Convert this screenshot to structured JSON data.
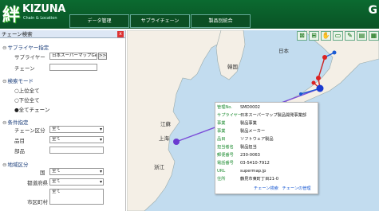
{
  "header": {
    "logo_kanji": "絆",
    "logo_text": "KIZUNA",
    "logo_sub": "Chain & Location",
    "tabs": [
      "データ管理",
      "サプライチェーン",
      "製品別統合"
    ],
    "right_mark": "G"
  },
  "sidebar": {
    "title": "チェーン検索",
    "close": "x",
    "supplier_section": "サプライヤー指定",
    "supplier_label": "サプライヤー",
    "supplier_value": "日本スーパーマップGeo",
    "supplier_btn": ">>",
    "chain_label": "チェーン",
    "chain_value": "",
    "mode_section": "検索モード",
    "modes": [
      "上位全て",
      "下位全て",
      "全てチェーン"
    ],
    "mode_selected": 2,
    "cond_section": "条件指定",
    "chain_cat_label": "チェーン区分",
    "chain_cat_value": "全て",
    "item_label": "品目",
    "item_value": "全て",
    "part_label": "部品",
    "part_value": "",
    "region_section": "地域区分",
    "country_label": "国",
    "country_value": "全て",
    "pref_label": "都道府県",
    "pref_value": "全て",
    "city_label": "市区町村",
    "city_value": "全て"
  },
  "map": {
    "labels": {
      "japan": "日本",
      "korea": "韓国",
      "shanghai": "上海",
      "jiangsu": "江蘇",
      "zhejiang": "浙江"
    },
    "tools": [
      "zoom-out-icon",
      "zoom-in-icon",
      "pan-icon",
      "rect-select-icon",
      "measure-icon",
      "layer-icon",
      "print-icon"
    ],
    "tool_glyphs": [
      "⊠",
      "⊞",
      "✋",
      "▭",
      "✎",
      "▤",
      "▦"
    ]
  },
  "popup": {
    "rows": [
      {
        "k": "管理No.",
        "v": "SMD0002"
      },
      {
        "k": "サプライヤー",
        "v": "日本スーパーマップ製品開発事業部"
      },
      {
        "k": "事業",
        "v": "製品事業"
      },
      {
        "k": "事業",
        "v": "製品メーカー"
      },
      {
        "k": "品目",
        "v": "ソフトウェア製品"
      },
      {
        "k": "担当者名",
        "v": "製品担当"
      },
      {
        "k": "郵便番号",
        "v": "230-0063"
      },
      {
        "k": "電話番号",
        "v": "03-5410-7912"
      },
      {
        "k": "URL",
        "v": "supermap.jp"
      },
      {
        "k": "住所",
        "v": "鶴見市東町丁目21-0"
      }
    ],
    "link_search": "チェーン検索",
    "link_manage": "チェーンの管理"
  }
}
